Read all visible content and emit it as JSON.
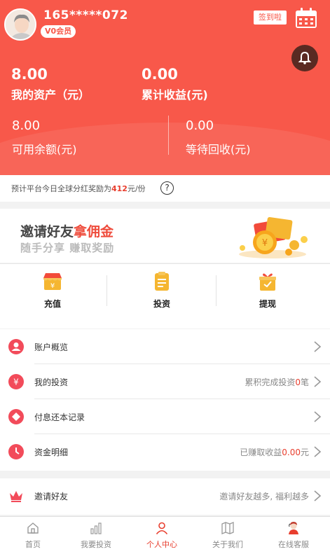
{
  "user": {
    "phone": "165*****072",
    "vip_level": "V0会员",
    "signin_label": "签到啦"
  },
  "assets": {
    "my_assets_value": "8.00",
    "my_assets_label": "我的资产（元）",
    "total_earnings_value": "0.00",
    "total_earnings_label": "累计收益(元)",
    "available_value": "8.00",
    "available_label": "可用余额(元)",
    "pending_value": "0.00",
    "pending_label": "等待回收(元)"
  },
  "notice": {
    "prefix": "预计平台今日全球分红奖励为",
    "amount": "412",
    "suffix": "元/份",
    "help": "?"
  },
  "banner": {
    "title_a": "邀请好友",
    "title_b": "拿佣金",
    "subtitle": "随手分享 赚取奖励"
  },
  "actions": [
    {
      "label": "充值"
    },
    {
      "label": "投资"
    },
    {
      "label": "提现"
    }
  ],
  "menu": {
    "account_overview": {
      "label": "账户概览"
    },
    "my_investment": {
      "label": "我的投资",
      "right_prefix": "累积完成投资",
      "right_value": "0",
      "right_suffix": "笔"
    },
    "interest_records": {
      "label": "付息还本记录"
    },
    "fund_details": {
      "label": "资金明细",
      "right_prefix": "已赚取收益",
      "right_value": "0.00",
      "right_suffix": "元"
    },
    "invite_friends": {
      "label": "邀请好友",
      "right": "邀请好友越多, 福利越多"
    }
  },
  "tabs": [
    {
      "label": "首页",
      "icon": "home-icon"
    },
    {
      "label": "我要投资",
      "icon": "chart-icon"
    },
    {
      "label": "个人中心",
      "icon": "user-icon",
      "active": true
    },
    {
      "label": "关于我们",
      "icon": "map-icon"
    },
    {
      "label": "在线客服",
      "icon": "service-icon"
    }
  ],
  "colors": {
    "brand": "#f8584a",
    "accent_red": "#e83e2e",
    "gold": "#f5b631"
  }
}
